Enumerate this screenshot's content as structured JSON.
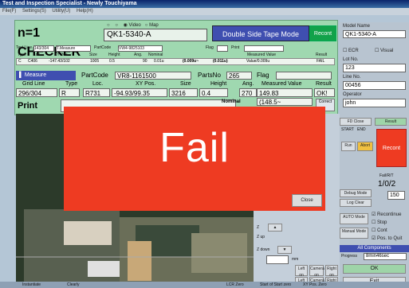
{
  "window": {
    "title": "Test and Inspection Specialist - Newly Touchiyama",
    "menu": [
      "File(F)",
      "Settings(S)",
      "Utility(U)",
      "Help(H)"
    ]
  },
  "header": {
    "station": "n=1 CHECKER",
    "part_code": "QK1-5340-A",
    "radio_options": [
      "",
      "",
      "Video",
      "Map"
    ],
    "mode_label": "Double Side Tape Mode",
    "recontent_label": "Recont"
  },
  "info_row": {
    "test_line_label": "Test Line",
    "test_line_value": "143/304",
    "measure_label": "T.Measure",
    "part_code_label": "PartCode",
    "part_code_value": "VW4-9825103",
    "flag_label": "Flag",
    "print_label": "Print",
    "columns": [
      "Type",
      "Loc.",
      "XY Pos.",
      "Size",
      "Height",
      "Ang.",
      "Nominal",
      "",
      "Measured Value",
      "Result"
    ],
    "row": [
      "C",
      "C406",
      "-147.43/102",
      "1005",
      "0.5",
      "",
      "90",
      "0.01u",
      "(0.009u~",
      "(0.011u)",
      "Value/0.009u",
      "FAIL"
    ]
  },
  "measure": {
    "label": "Measure",
    "part_code_label": "PartCode",
    "part_code_value": "VR8-1161500",
    "parts_no_label": "PartsNo",
    "parts_no_value": "265",
    "flag_label": "Flag"
  },
  "grid": {
    "headers": [
      "Grid Line",
      "Type",
      "Loc.",
      "XY Pos.",
      "Size",
      "Height",
      "Ang.",
      "Measured Value",
      "Result"
    ],
    "values": [
      "296/304",
      "R",
      "R731",
      "-94.93/99.35",
      "3216",
      "0.4",
      "270",
      "149.83",
      "OK!"
    ]
  },
  "print": {
    "label": "Print",
    "nominal_label": "Nominal",
    "nominal_value": "(148.5~",
    "correct_label": "Correct"
  },
  "overlay": {
    "fail_text": "Fail",
    "close_label": "Close"
  },
  "right_panel": {
    "model_name_label": "Model Name",
    "model_name_value": "QK1-5340-A",
    "ecr_label": "ECR",
    "visual_label": "Visual",
    "lot_no_label": "Lot No.",
    "lot_no_value": "123",
    "line_no_label": "Line No.",
    "line_no_value": "00456",
    "operator_label": "Operator",
    "operator_value": "john",
    "result_label": "Result",
    "fd_close_label": "FD Close",
    "start_label": "START",
    "end_label": "END",
    "recontent_label": "Recont",
    "run_label": "Run",
    "abort_label": "Abort",
    "fail_r_label": "Fail/R/T",
    "count_value": "1/0/2",
    "zoom_value": "150",
    "auto_mode_label": "AUTO Mode",
    "manual_mode_label": "Manual Mode",
    "debug_mode_label": "Debug Mode",
    "log_clear_label": "Log Clear",
    "recontinue_label": "Recontinue",
    "stop_label": "Stop",
    "cont_label": "Cont",
    "pos_to_quit_label": "Pos. to Quit",
    "all_components_label": "All Components",
    "progress_label": "Progress",
    "progress_value": "8min46sec",
    "ok_label": "OK",
    "exit_label": "Exit"
  },
  "controls": {
    "z_up": "Z up",
    "z_down": "Z down",
    "z_label": "Z",
    "left_on": "Left on",
    "camera_on": "Camera on",
    "right_on": "Right on",
    "left_off": "Left off",
    "camera_off": "Camera off",
    "right_off": "Right off",
    "mm_label": "mm"
  },
  "status": {
    "items": [
      "Instantiate",
      "Clearly",
      "LCR Zero",
      "Start of Start zero",
      "XY Pos. Zero"
    ]
  },
  "colors": {
    "accent_blue": "#3f4fb0",
    "panel_green": "#9fd8b0",
    "fail_red": "#ee3b22",
    "recont_green": "#12a24a"
  }
}
